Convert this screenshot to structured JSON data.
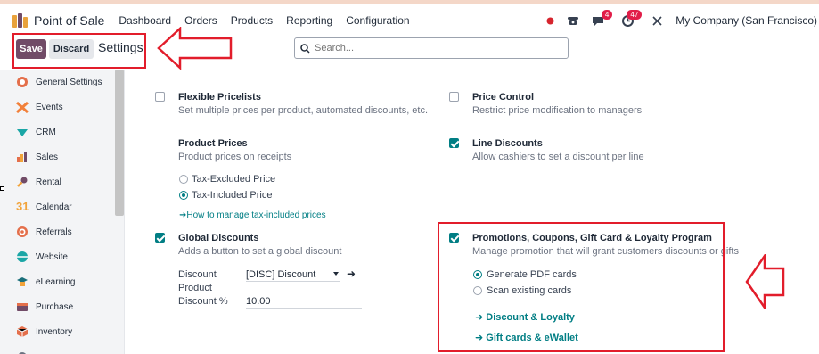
{
  "topbar": {
    "app_name": "Point of Sale",
    "menu": [
      "Dashboard",
      "Orders",
      "Products",
      "Reporting",
      "Configuration"
    ],
    "messages_count": "4",
    "activities_count": "47",
    "company": "My Company (San Francisco)"
  },
  "control_panel": {
    "save_label": "Save",
    "discard_label": "Discard",
    "breadcrumb": "Settings"
  },
  "search": {
    "placeholder": "Search..."
  },
  "sidebar": {
    "items": [
      {
        "label": "General Settings",
        "icon": "odoo-icon"
      },
      {
        "label": "Events",
        "icon": "events-icon"
      },
      {
        "label": "CRM",
        "icon": "crm-icon"
      },
      {
        "label": "Sales",
        "icon": "sales-icon"
      },
      {
        "label": "Rental",
        "icon": "rental-icon"
      },
      {
        "label": "Calendar",
        "icon": "calendar-icon"
      },
      {
        "label": "Referrals",
        "icon": "referrals-icon"
      },
      {
        "label": "Website",
        "icon": "website-icon"
      },
      {
        "label": "eLearning",
        "icon": "elearning-icon"
      },
      {
        "label": "Purchase",
        "icon": "purchase-icon"
      },
      {
        "label": "Inventory",
        "icon": "inventory-icon"
      }
    ]
  },
  "settings": {
    "flexible_pricelists": {
      "title": "Flexible Pricelists",
      "desc": "Set multiple prices per product, automated discounts, etc.",
      "checked": false
    },
    "price_control": {
      "title": "Price Control",
      "desc": "Restrict price modification to managers",
      "checked": false
    },
    "product_prices": {
      "title": "Product Prices",
      "desc": "Product prices on receipts",
      "options": [
        "Tax-Excluded Price",
        "Tax-Included Price"
      ],
      "selected": "Tax-Included Price",
      "link": "How to manage tax-included prices"
    },
    "line_discounts": {
      "title": "Line Discounts",
      "desc": "Allow cashiers to set a discount per line",
      "checked": true
    },
    "global_discounts": {
      "title": "Global Discounts",
      "desc": "Adds a button to set a global discount",
      "checked": true,
      "discount_product_label_1": "Discount",
      "discount_product_label_2": "Product",
      "discount_product_value": "[DISC] Discount",
      "discount_pct_label": "Discount %",
      "discount_pct_value": "10.00"
    },
    "promotions": {
      "title": "Promotions, Coupons, Gift Card & Loyalty Program",
      "desc": "Manage promotion that will grant customers discounts or gifts",
      "checked": true,
      "options": [
        "Generate PDF cards",
        "Scan existing cards"
      ],
      "selected": "Generate PDF cards",
      "link1": "Discount & Loyalty",
      "link2": "Gift cards & eWallet"
    }
  },
  "colors": {
    "primary": "#714b67",
    "accent": "#017e84",
    "annotation": "#e21d2b"
  }
}
